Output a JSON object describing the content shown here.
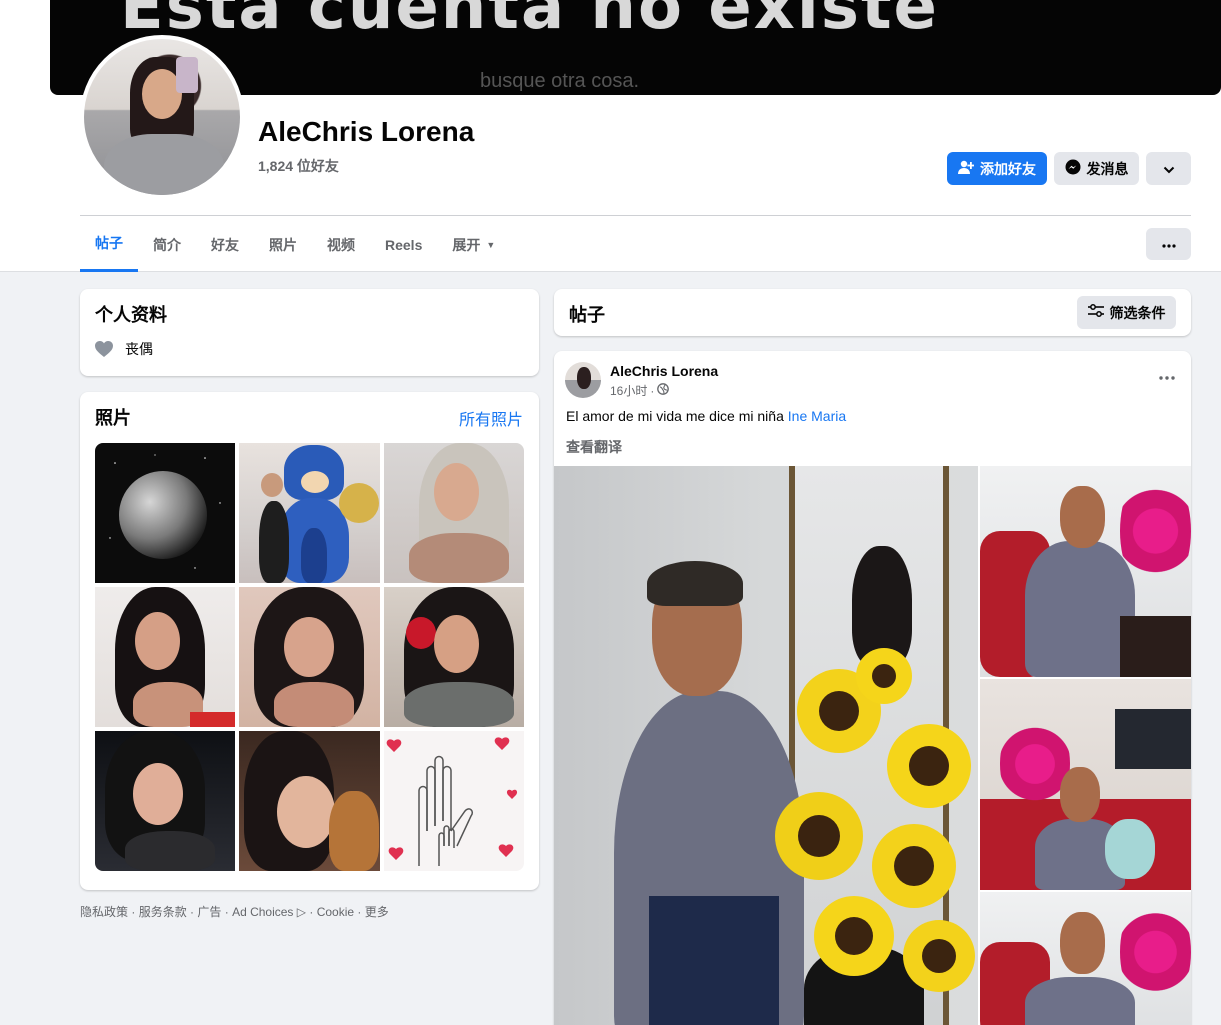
{
  "cover": {
    "headline": "Esta cuenta no existe",
    "subline": "busque otra cosa."
  },
  "profile": {
    "name": "AleChris Lorena",
    "friends": "1,824 位好友"
  },
  "actions": {
    "add_friend": "添加好友",
    "message": "发消息"
  },
  "tabs": [
    {
      "label": "帖子"
    },
    {
      "label": "简介"
    },
    {
      "label": "好友"
    },
    {
      "label": "照片"
    },
    {
      "label": "视频"
    },
    {
      "label": "Reels"
    },
    {
      "label": "展开"
    }
  ],
  "intro": {
    "title": "个人资料",
    "relationship": "丧偶"
  },
  "photos": {
    "title": "照片",
    "all_link": "所有照片"
  },
  "footer": {
    "privacy": "隐私政策",
    "terms": "服务条款",
    "ads": "广告",
    "ad_choices": "Ad Choices",
    "cookie": "Cookie",
    "more": "更多"
  },
  "posts_header": {
    "title": "帖子",
    "filter": "筛选条件"
  },
  "post": {
    "author": "AleChris Lorena",
    "time": "16小时",
    "text": "El amor de mi vida me dice mi niña ",
    "mention": "Ine Maria",
    "translate": "查看翻译"
  },
  "colors": {
    "accent": "#1877f2",
    "background": "#f0f2f5",
    "secondary_text": "#65676b"
  },
  "icons": {
    "add_friend": "person-plus-icon",
    "message": "messenger-icon",
    "more": "chevron-down-icon",
    "menu": "more-dots-icon",
    "relationship": "heart-icon",
    "filter": "sliders-icon",
    "audience": "globe-icon"
  }
}
